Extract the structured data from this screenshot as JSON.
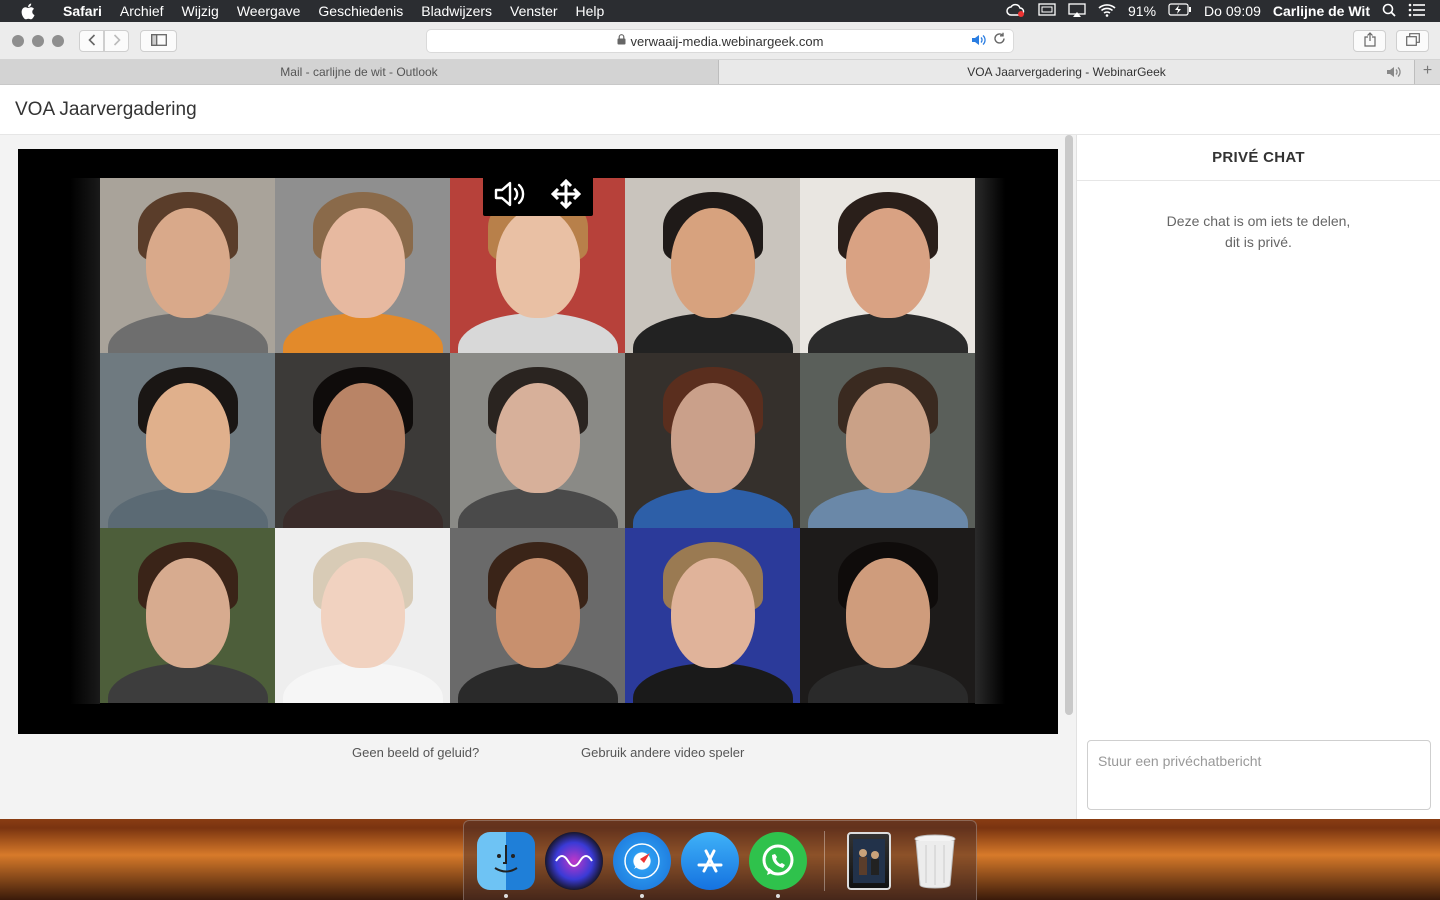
{
  "menubar": {
    "app_name": "Safari",
    "menus": [
      "Archief",
      "Wijzig",
      "Weergave",
      "Geschiedenis",
      "Bladwijzers",
      "Venster",
      "Help"
    ],
    "battery": "91%",
    "clock": "Do 09:09",
    "user": "Carlijne de Wit"
  },
  "browser": {
    "url": "verwaaij-media.webinargeek.com",
    "tabs": [
      {
        "title": "Mail - carlijne de wit - Outlook",
        "active": false
      },
      {
        "title": "VOA Jaarvergadering - WebinarGeek",
        "active": true
      }
    ]
  },
  "page": {
    "title": "VOA Jaarvergadering",
    "links": {
      "no_video": "Geen beeld of geluid?",
      "other_player": "Gebruik andere video speler"
    }
  },
  "video": {
    "controls": [
      "volume-icon",
      "move-icon"
    ],
    "participants": 15
  },
  "chat": {
    "header": "PRIVÉ CHAT",
    "empty_line1": "Deze chat is om iets te delen,",
    "empty_line2": "dit is privé.",
    "input_placeholder": "Stuur een privéchatbericht"
  },
  "dock": {
    "apps": [
      "finder-icon",
      "siri-icon",
      "safari-icon",
      "app-store-icon",
      "whatsapp-icon",
      "downloads-stack-icon",
      "trash-icon"
    ]
  }
}
